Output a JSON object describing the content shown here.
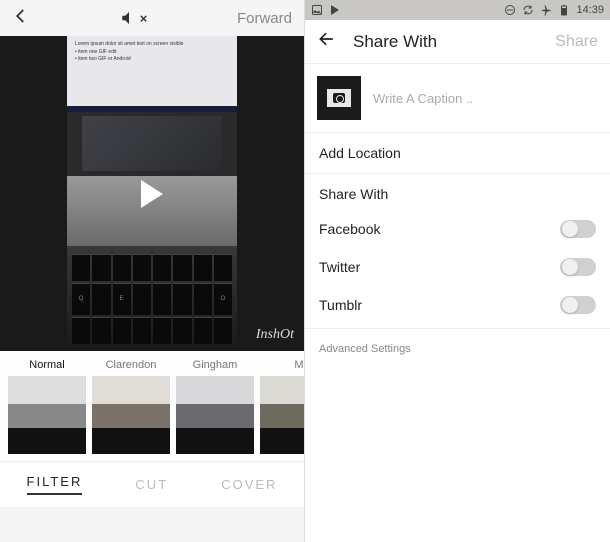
{
  "left": {
    "header": {
      "forward": "Forward"
    },
    "watermark": "InshOt",
    "filters": [
      {
        "label": "Normal",
        "active": true
      },
      {
        "label": "Clarendon",
        "active": false
      },
      {
        "label": "Gingham",
        "active": false
      },
      {
        "label": "M",
        "active": false
      }
    ],
    "tabs": {
      "filter": "FILTER",
      "cut": "CUT",
      "cover": "COVER"
    }
  },
  "right": {
    "status": {
      "time": "14:39"
    },
    "header": {
      "title": "Share With",
      "share": "Share"
    },
    "caption_placeholder": "Write A Caption ..",
    "add_location": "Add Location",
    "share_with_label": "Share With",
    "services": [
      {
        "name": "Facebook",
        "on": false
      },
      {
        "name": "Twitter",
        "on": false
      },
      {
        "name": "Tumblr",
        "on": false
      }
    ],
    "advanced": "Advanced Settings"
  }
}
